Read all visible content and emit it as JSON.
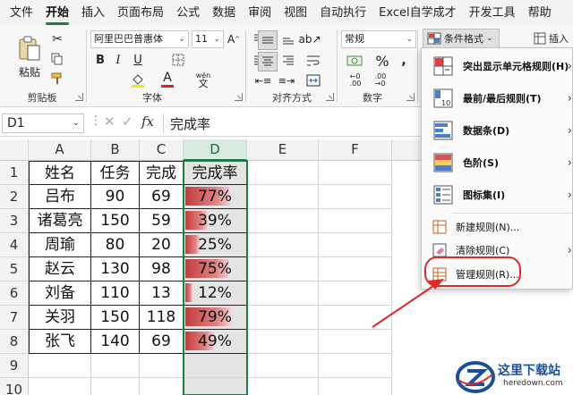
{
  "menubar": {
    "tabs": [
      "文件",
      "开始",
      "插入",
      "页面布局",
      "公式",
      "数据",
      "审阅",
      "视图",
      "自动执行",
      "Excel自学成才",
      "开发工具",
      "帮助"
    ],
    "active_index": 1
  },
  "ribbon": {
    "paste_label": "粘贴",
    "groups": {
      "clipboard": "剪贴板",
      "font": "字体",
      "alignment": "对齐方式",
      "number": "数字"
    },
    "font_name": "阿里巴巴普惠体",
    "font_size": "11",
    "number_format": "常规",
    "bold": "B",
    "italic": "I",
    "underline": "U",
    "font_color_glyph": "A",
    "wen_glyph": "wén",
    "percent": "%",
    "conditional_format_label": "条件格式",
    "insert_label": "插入"
  },
  "formula_bar": {
    "name_box": "D1",
    "fx": "fx",
    "value": "完成率"
  },
  "grid": {
    "columns": [
      "A",
      "B",
      "C",
      "D",
      "E",
      "F"
    ],
    "row_numbers": [
      "1",
      "2",
      "3",
      "4",
      "5",
      "6",
      "7",
      "8",
      "9",
      "10"
    ],
    "header": [
      "姓名",
      "任务",
      "完成",
      "完成率"
    ],
    "rows": [
      {
        "name": "吕布",
        "task": "90",
        "done": "69",
        "rate": "77%",
        "fill": 0.77
      },
      {
        "name": "诸葛亮",
        "task": "150",
        "done": "59",
        "rate": "39%",
        "fill": 0.39
      },
      {
        "name": "周瑜",
        "task": "80",
        "done": "20",
        "rate": "25%",
        "fill": 0.25
      },
      {
        "name": "赵云",
        "task": "130",
        "done": "98",
        "rate": "75%",
        "fill": 0.75
      },
      {
        "name": "刘备",
        "task": "110",
        "done": "13",
        "rate": "12%",
        "fill": 0.12
      },
      {
        "name": "关羽",
        "task": "150",
        "done": "118",
        "rate": "79%",
        "fill": 0.79
      },
      {
        "name": "张飞",
        "task": "140",
        "done": "69",
        "rate": "49%",
        "fill": 0.49
      }
    ]
  },
  "cf_menu": {
    "items": [
      {
        "label": "突出显示单元格规则(H)",
        "submenu": true
      },
      {
        "label": "最前/最后规则(T)",
        "submenu": true
      },
      {
        "label": "数据条(D)",
        "submenu": true
      },
      {
        "label": "色阶(S)",
        "submenu": true
      },
      {
        "label": "图标集(I)",
        "submenu": true
      },
      {
        "label": "新建规则(N)...",
        "submenu": false
      },
      {
        "label": "清除规则(C)",
        "submenu": true
      },
      {
        "label": "管理规则(R)...",
        "submenu": false
      }
    ],
    "top_value": "10"
  },
  "watermark": {
    "text": "这里下载站",
    "url": "heredown.com"
  },
  "colors": {
    "accent": "#1e7a43",
    "databar": "#c43b3b",
    "annotation": "#e02a2a"
  }
}
